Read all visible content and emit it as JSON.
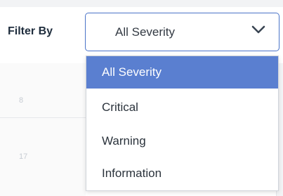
{
  "filter": {
    "label": "Filter By",
    "selected_value": "All Severity",
    "options": [
      "All Severity",
      "Critical",
      "Warning",
      "Information"
    ]
  },
  "background_table": {
    "cells": [
      "8",
      "17"
    ]
  },
  "colors": {
    "accent": "#4a73c8",
    "selected_option_bg": "#5a7fd0"
  },
  "icons": {
    "select_arrow": "chevron-down-icon"
  }
}
